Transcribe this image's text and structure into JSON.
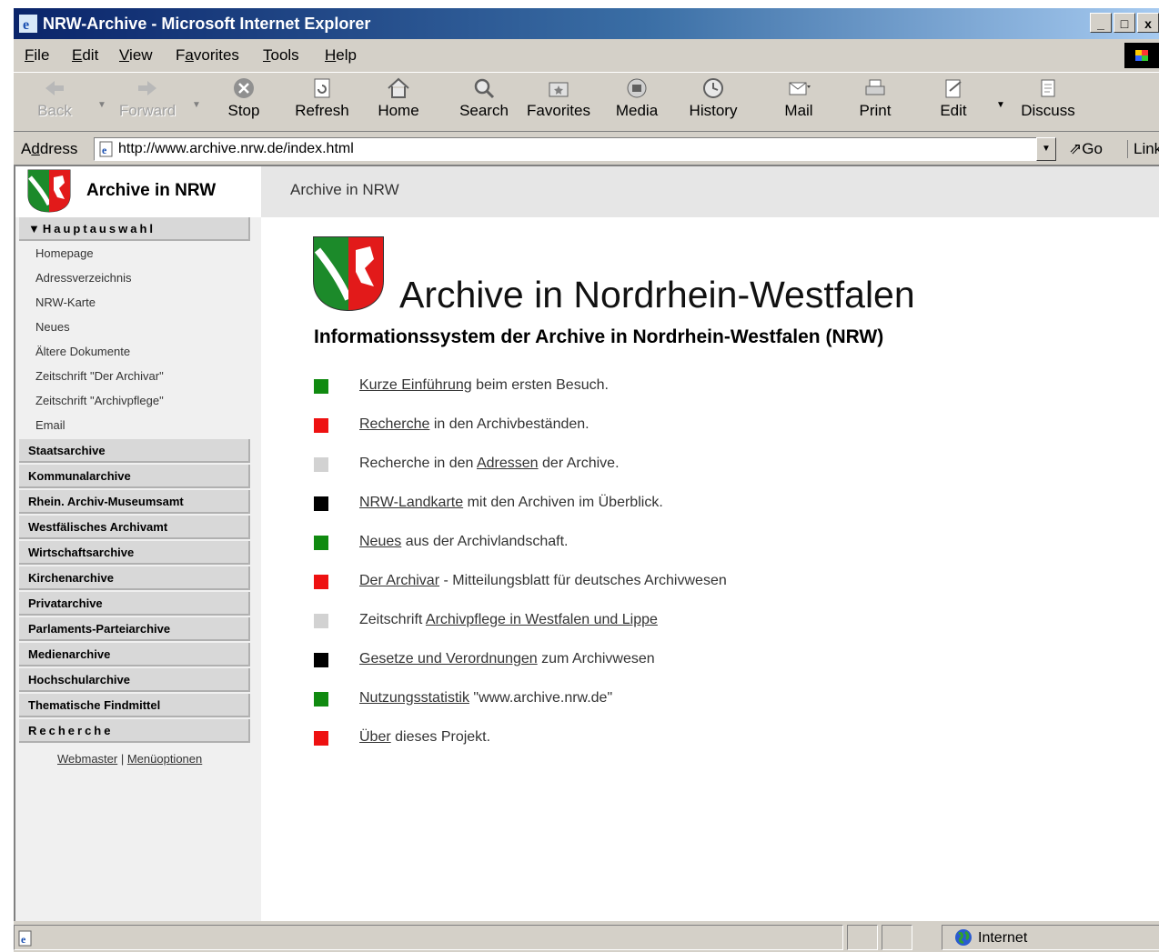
{
  "window": {
    "title": "NRW-Archive - Microsoft Internet Explorer",
    "controls": [
      "_",
      "□",
      "x"
    ]
  },
  "menu": {
    "file": {
      "key": "F",
      "rest": "ile"
    },
    "edit": {
      "key": "E",
      "rest": "dit"
    },
    "view": {
      "key": "V",
      "rest": "iew"
    },
    "favorites": {
      "first": "F",
      "key": "a",
      "rest": "vorites"
    },
    "tools": {
      "key": "T",
      "rest": "ools"
    },
    "help": {
      "key": "H",
      "rest": "elp"
    }
  },
  "toolbar": {
    "back": "Back",
    "forward": "Forward",
    "stop": "Stop",
    "refresh": "Refresh",
    "home": "Home",
    "search": "Search",
    "favorites": "Favorites",
    "media": "Media",
    "history": "History",
    "mail": "Mail",
    "print": "Print",
    "edit": "Edit",
    "discuss": "Discuss"
  },
  "address": {
    "label_first": "A",
    "label_key": "d",
    "label_rest": "dress",
    "url": "http://www.archive.nrw.de/index.html",
    "go": "Go",
    "links": "Links"
  },
  "sidebar": {
    "title": "Archive in NRW",
    "main_section": "▼Hauptauswahl",
    "main_links": [
      "Homepage",
      "Adressverzeichnis",
      "NRW-Karte",
      "Neues",
      "Ältere Dokumente",
      "Zeitschrift \"Der Archivar\"",
      "Zeitschrift \"Archivpflege\"",
      "Email"
    ],
    "sections": [
      "Staatsarchive",
      "Kommunalarchive",
      "Rhein. Archiv-Museumsamt",
      "Westfälisches Archivamt",
      "Wirtschaftsarchive",
      "Kirchenarchive",
      "Privatarchive",
      "Parlaments-Parteiarchive",
      "Medienarchive",
      "Hochschularchive",
      "Thematische Findmittel"
    ],
    "search_section": "Recherche",
    "footer": {
      "webmaster": "Webmaster",
      "sep": " | ",
      "options": "Menüoptionen"
    }
  },
  "main": {
    "breadcrumb": "Archive in NRW",
    "title": "Archive in Nordrhein-Westfalen",
    "subtitle": "Informationssystem der Archive in Nordrhein-Westfalen (NRW)",
    "items": [
      {
        "color": "#108a10",
        "before": "",
        "link": "Kurze Einführung",
        "after": " beim ersten Besuch."
      },
      {
        "color": "#ee1111",
        "before": "",
        "link": "Recherche",
        "after": " in den Archivbeständen."
      },
      {
        "color": "#d2d2d2",
        "before": "Recherche in den ",
        "link": "Adressen",
        "after": " der Archive."
      },
      {
        "color": "#000000",
        "before": "",
        "link": "NRW-Landkarte",
        "after": " mit den Archiven im Überblick."
      },
      {
        "color": "#108a10",
        "before": "",
        "link": "Neues",
        "after": " aus der Archivlandschaft."
      },
      {
        "color": "#ee1111",
        "before": "",
        "link": "Der Archivar",
        "after": " - Mitteilungsblatt für deutsches Archivwesen"
      },
      {
        "color": "#d2d2d2",
        "before": "Zeitschrift ",
        "link": "Archivpflege in Westfalen und Lippe",
        "after": ""
      },
      {
        "color": "#000000",
        "before": "",
        "link": "Gesetze und Verordnungen",
        "after": " zum Archivwesen"
      },
      {
        "color": "#108a10",
        "before": "",
        "link": "Nutzungsstatistik",
        "after": " \"www.archive.nrw.de\""
      },
      {
        "color": "#ee1111",
        "before": "",
        "link": "Über",
        "after": " dieses Projekt."
      }
    ]
  },
  "status": {
    "zone": "Internet"
  }
}
